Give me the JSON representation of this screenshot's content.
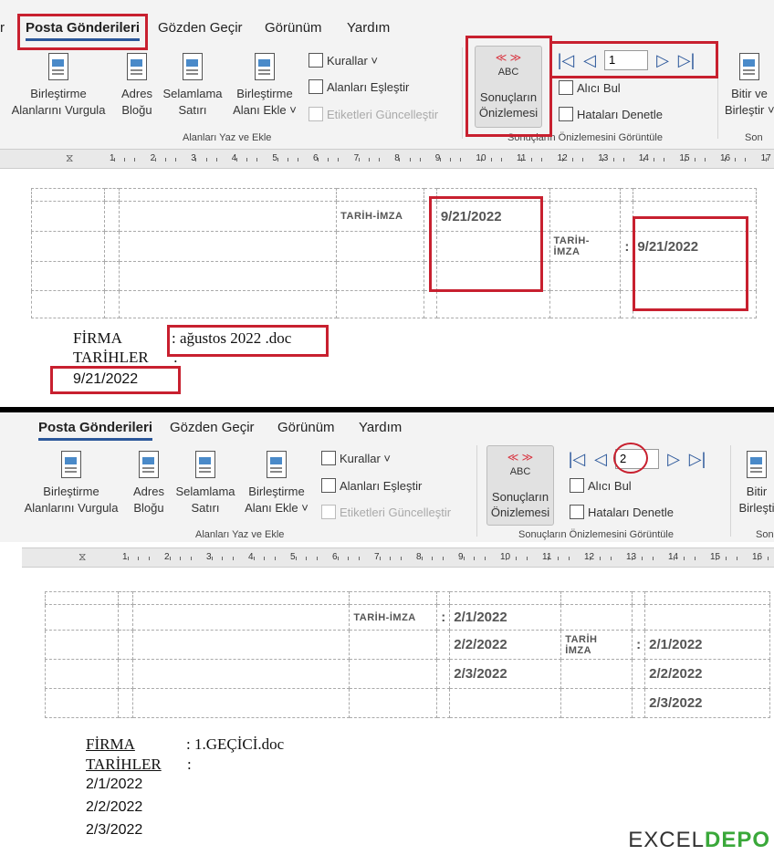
{
  "colors": {
    "ribbon_bg": "#f3f3f3",
    "accent_blue": "#2b579a",
    "highlight_red": "#c8202f",
    "logo_green": "#3aa83a"
  },
  "ribbon": {
    "tabs_top": [
      "r",
      "Posta Gönderileri",
      "Gözden Geçir",
      "Görünüm",
      "Yardım"
    ],
    "tabs_bottom": [
      "Posta Gönderileri",
      "Gözden Geçir",
      "Görünüm",
      "Yardım"
    ],
    "write_insert": {
      "highlight_fields": [
        "Birleştirme",
        "Alanlarını Vurgula"
      ],
      "address_block": [
        "Adres",
        "Bloğu"
      ],
      "greeting_line": [
        "Selamlama",
        "Satırı"
      ],
      "insert_field": [
        "Birleştirme",
        "Alanı Ekle ˅"
      ],
      "rules": "Kurallar ˅",
      "match_fields": "Alanları Eşleştir",
      "update_labels": "Etiketleri Güncelleştir",
      "group_label": "Alanları Yaz ve Ekle"
    },
    "preview": {
      "abc": "ABC",
      "preview_results": [
        "Sonuçların",
        "Önizlemesi"
      ],
      "find_recipient": "Alıcı Bul",
      "check_errors": "Hataları Denetle",
      "group_label": "Sonuçların Önizlemesini Görüntüle",
      "record_top": "1",
      "record_bottom": "2"
    },
    "finish": {
      "finish_merge_top": [
        "Bitir ve",
        "Birleştir ˅"
      ],
      "finish_merge_bottom": [
        "Bitir",
        "Birleşti"
      ],
      "group_label_top": "Son",
      "group_label_bottom": "Son"
    }
  },
  "ruler": {
    "top_numbers": [
      "1",
      "2",
      "3",
      "4",
      "5",
      "6",
      "7",
      "8",
      "9",
      "10",
      "11",
      "12",
      "13",
      "14",
      "15",
      "16",
      "17"
    ],
    "bottom_numbers": [
      "1",
      "2",
      "3",
      "4",
      "5",
      "6",
      "7",
      "8",
      "9",
      "10",
      "11",
      "12",
      "13",
      "14",
      "15",
      "16"
    ]
  },
  "doc_top": {
    "tarih_imza": "TARİH-İMZA",
    "colon": ":",
    "date_1": "9/21/2022",
    "tarih_label": "TARİH-",
    "imza_label": "İMZA",
    "date_2": "9/21/2022",
    "firma": "FİRMA",
    "firma_value": ": ağustos 2022 .doc",
    "tarihler": "TARİHLER",
    "tarihler_colon": ":",
    "date_list": [
      "9/21/2022"
    ]
  },
  "doc_bottom": {
    "tarih_imza": "TARİH-İMZA",
    "colon": ":",
    "dates_col1": [
      "2/1/2022",
      "2/2/2022",
      "2/3/2022"
    ],
    "tarih_label": "TARİH",
    "imza_label": "İMZA",
    "dates_col2": [
      "2/1/2022",
      "2/2/2022",
      "2/3/2022"
    ],
    "firma": "FİRMA",
    "firma_value": ": 1.GEÇİCİ.doc",
    "tarihler": "TARİHLER",
    "tarihler_colon": ":",
    "date_list": [
      "2/1/2022",
      "2/2/2022",
      "2/3/2022"
    ]
  },
  "logo": {
    "part1": "EXCEL",
    "part2": "DEPO"
  }
}
